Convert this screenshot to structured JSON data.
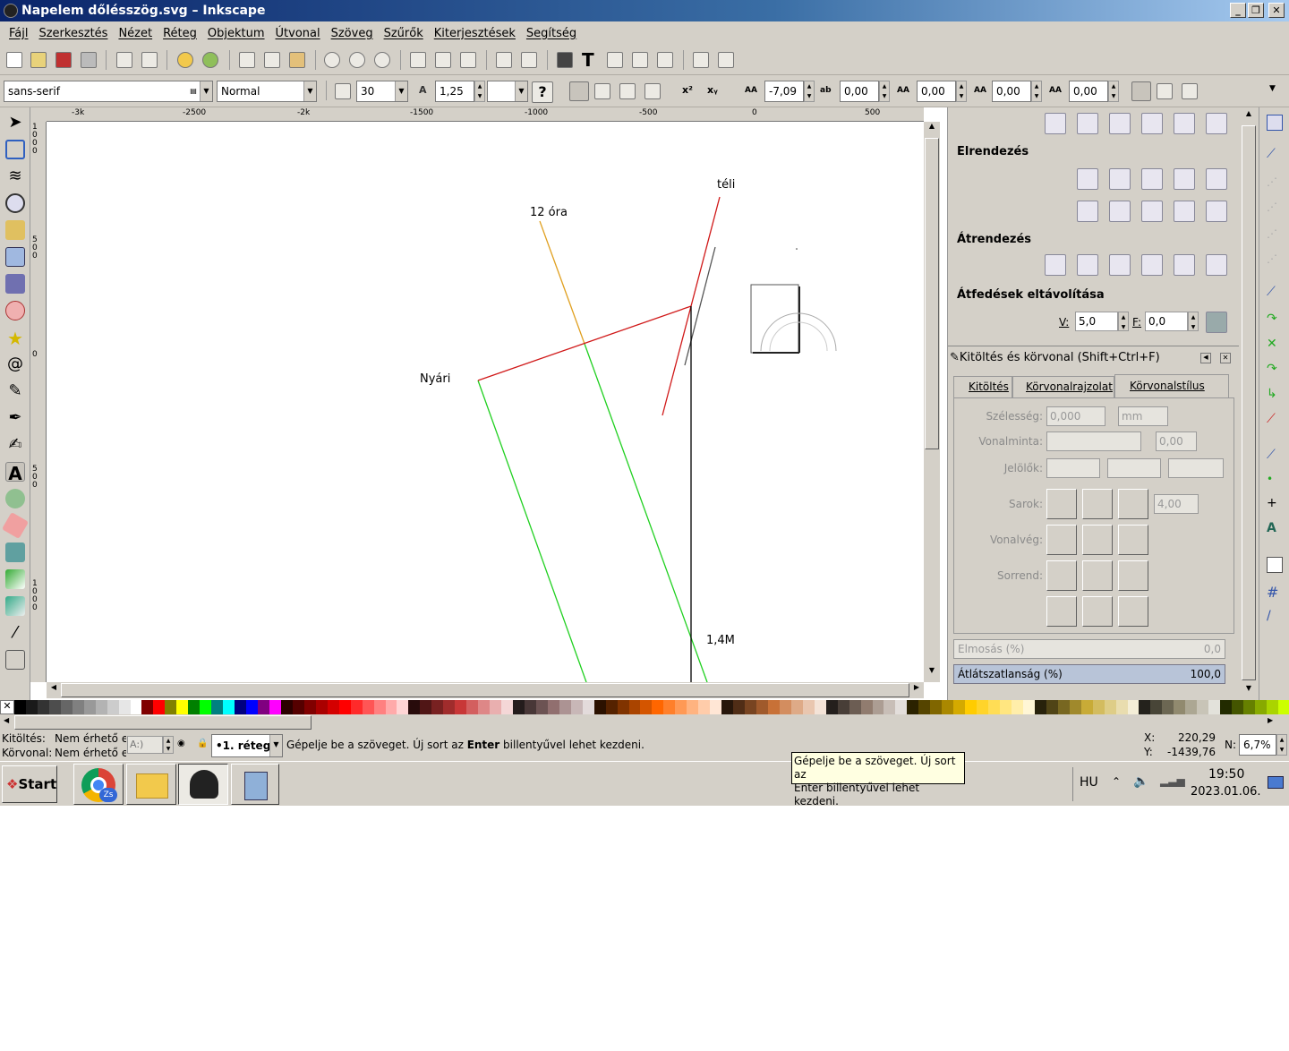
{
  "window": {
    "title": "Napelem dőlésszög.svg – Inkscape",
    "buttons": [
      "_",
      "❐",
      "✕"
    ]
  },
  "menu": [
    "Fájl",
    "Szerkesztés",
    "Nézet",
    "Réteg",
    "Objektum",
    "Útvonal",
    "Szöveg",
    "Szűrők",
    "Kiterjesztések",
    "Segítség"
  ],
  "textbar": {
    "font_family": "sans-serif",
    "font_style": "Normal",
    "font_size": "30",
    "line_spacing": "1,25",
    "help": "?",
    "letter_spacing": "-7,09",
    "word_spacing": "0,00",
    "kerning": "0,00",
    "vshift": "0,00",
    "rotation": "0,00",
    "superscript": "x²",
    "subscript": "xᵧ",
    "aa_label": "AA"
  },
  "ruler": {
    "top": [
      "-3k",
      "-2500",
      "-2k",
      "-1500",
      "-1000",
      "-500",
      "0",
      "500"
    ],
    "left": [
      "1000",
      "500",
      "0",
      "500",
      "1000"
    ]
  },
  "canvas": {
    "labels": {
      "teli": "téli",
      "ora12": "12 óra",
      "nyari": "Nyári",
      "m14": "1,4M"
    }
  },
  "panel": {
    "align_heading": "Elrendezés",
    "rearrange_heading": "Átrendezés",
    "overlap_heading": "Átfedések eltávolítása",
    "overlap_h_label": "V:",
    "overlap_h_value": "5,0",
    "overlap_v_label": "F:",
    "overlap_v_value": "0,0",
    "dialog_title": "Kitöltés és körvonal (Shift+Ctrl+F)",
    "tabs": [
      "Kitöltés",
      "Körvonalrajzolat",
      "Körvonalstílus"
    ],
    "width_label": "Szélesség:",
    "width_value": "0,000",
    "width_unit": "mm",
    "dash_label": "Vonalminta:",
    "dash_value": "0,00",
    "markers_label": "Jelölők:",
    "join_label": "Sarok:",
    "join_value": "4,00",
    "cap_label": "Vonalvég:",
    "order_label": "Sorrend:",
    "blur_label": "Elmosás (%)",
    "blur_value": "0,0",
    "opacity_label": "Átlátszatlanság (%)",
    "opacity_value": "100,0"
  },
  "status": {
    "fill_label": "Kitöltés:",
    "fill_value": "Nem érhető el",
    "stroke_label": "Körvonal:",
    "stroke_value": "Nem érhető el",
    "opacity_field": "A:)",
    "layer": "•1. réteg",
    "message_pre": "Gépelje be a szöveget. Új sort az ",
    "message_key": "Enter",
    "message_post": " billentyűvel lehet kezdeni.",
    "x_label": "X:",
    "x_value": "220,29",
    "y_label": "Y:",
    "y_value": "-1439,76",
    "zoom_label": "N:",
    "zoom_value": "6,7%"
  },
  "tooltip": {
    "line1": "Gépelje be a szöveget. Új sort az",
    "line2": "Enter billentyűvel lehet kezdeni."
  },
  "taskbar": {
    "start": "Start",
    "lang": "HU",
    "time": "19:50",
    "date": "2023.01.06.",
    "chrome_badge": "Zs"
  },
  "colors": {
    "palette": [
      "#000000",
      "#1a1a1a",
      "#333333",
      "#4d4d4d",
      "#666666",
      "#808080",
      "#999999",
      "#b3b3b3",
      "#cccccc",
      "#e6e6e6",
      "#ffffff",
      "#800000",
      "#ff0000",
      "#808000",
      "#ffff00",
      "#008000",
      "#00ff00",
      "#008080",
      "#00ffff",
      "#000080",
      "#0000ff",
      "#800080",
      "#ff00ff",
      "#2b0000",
      "#550000",
      "#800000",
      "#aa0000",
      "#d40000",
      "#ff0000",
      "#ff2a2a",
      "#ff5555",
      "#ff8080",
      "#ffaaaa",
      "#ffd5d5",
      "#280b0b",
      "#501616",
      "#782121",
      "#a02c2c",
      "#c83737",
      "#d35f5f",
      "#de8787",
      "#e9afaf",
      "#f4d7d7",
      "#241c1c",
      "#483737",
      "#6c5353",
      "#916f6f",
      "#ac9393",
      "#c8b7b7",
      "#e3dbdb",
      "#2b1100",
      "#552200",
      "#803300",
      "#aa4400",
      "#d45500",
      "#ff6600",
      "#ff7f2a",
      "#ff9955",
      "#ffb380",
      "#ffccaa",
      "#ffe6d5",
      "#28170b",
      "#502d16",
      "#784421",
      "#a05a2c",
      "#c87137",
      "#d38d5f",
      "#deaa87",
      "#e9c6af",
      "#f4e3d7",
      "#241f1c",
      "#483e37",
      "#6c5d53",
      "#917c6f",
      "#ac9d93",
      "#c8beb7",
      "#e3dedb",
      "#2b2200",
      "#554400",
      "#806600",
      "#aa8800",
      "#d4aa00",
      "#ffcc00",
      "#ffd42a",
      "#ffdd55",
      "#ffe680",
      "#ffeeaa",
      "#fff6d5",
      "#28220b",
      "#504416",
      "#786721",
      "#a0892c",
      "#c8ab37",
      "#d3bc5f",
      "#decd87",
      "#e9ddaf",
      "#f4eed7",
      "#24221c",
      "#484537",
      "#6c6753",
      "#918a6f",
      "#aca793",
      "#c8c4b7",
      "#e3e2db",
      "#222b00",
      "#445500",
      "#668000",
      "#88aa00",
      "#aad400",
      "#ccff00"
    ]
  }
}
